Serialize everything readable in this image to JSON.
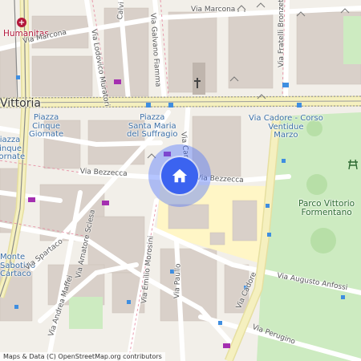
{
  "map": {
    "attribution": "Maps & Data (C) OpenStreetMap.org contributors",
    "location_marker": {
      "icon": "home-icon",
      "color": "#3b63f0"
    }
  },
  "labels": {
    "humanitas": "Humanitas",
    "vittoria": "Vittoria",
    "piazza_cinque_giornate": "Piazza\nCinque\nGiornate",
    "piazza_cinque_giornate_left": "Piazza\nCinque\nGiornate",
    "piazza_santa_maria": "Piazza\nSanta Maria\ndel Suffragio",
    "viale_cadore_stop": "Via Cadore - Corso\nVentidue\nMarzo",
    "parco": "Parco Vittorio\nFormentano",
    "monte_sabotino": "Monte\nSabotino\nCartaco",
    "via_marcona_top": "Via Marcona",
    "via_marcona_left": "Via Marcona",
    "via_calvi": "Calvi",
    "via_galvano_fiamma": "Via Galvano Fiamma",
    "via_fratelli_bronzetti": "Via Fratelli Bronzetti",
    "via_lodovico_muratori": "Via Lodovico Muratori",
    "via_bezzecca_left": "Via Bezzecca",
    "via_bezzecca_right": "Via Bezzecca",
    "via_carlo": "Via Car",
    "via_amatore_sciesa": "Via Amatore Sciesa",
    "via_spartaco": "Via Spartaco",
    "via_andrea_maffei": "Via Andrea Maffei",
    "via_emilio_morosini": "Via Emilio Morosini",
    "via_paullo": "Via Paullo",
    "via_cadore": "Via Cadore",
    "via_augusto_anfossi": "Via Augusto Anfossi",
    "via_perugino": "Via Perugino"
  },
  "colors": {
    "background": "#f2efe9",
    "park": "#cdebc1",
    "school": "#fff6c6",
    "main_road": "#f5f0bf",
    "tram": "#9b9b9b",
    "building": "#d9d0c9",
    "parking_blue": "#3f8ee0",
    "shop_purple": "#a42fb0"
  }
}
